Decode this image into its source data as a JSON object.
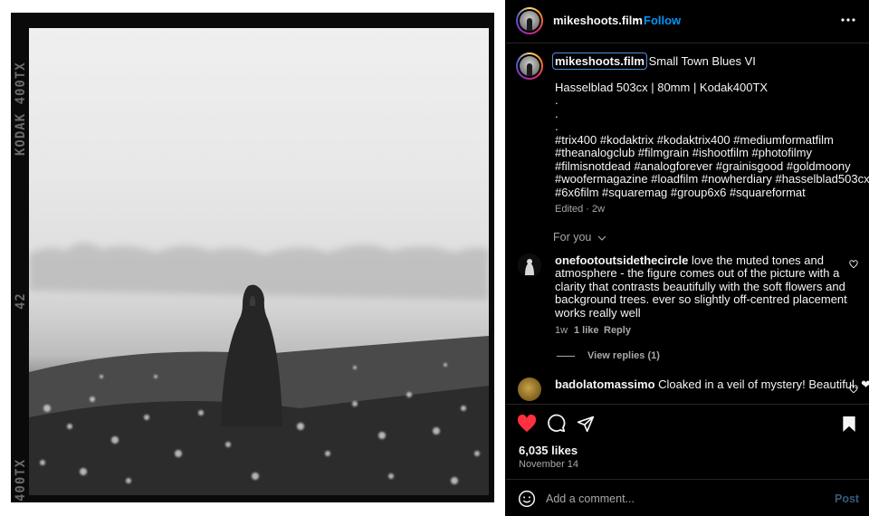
{
  "photo": {
    "edge_labels": [
      "KODAK 400TX",
      "42",
      "400TX"
    ]
  },
  "header": {
    "username": "mikeshoots.film",
    "separator": "•",
    "follow_label": "Follow",
    "more_icon": "more-horizontal-icon"
  },
  "caption": {
    "username": "mikeshoots.film",
    "title": "Small Town Blues VI",
    "camera": "Hasselblad 503cx | 80mm | Kodak400TX",
    "dots": [
      ".",
      ".",
      "."
    ],
    "hashtags": [
      "#trix400 #kodaktrix #kodaktrix400 #mediumformatfilm",
      "#theanalogclub #filmgrain #ishootfilm #photofilmy",
      "#filmisnotdead #analogforever #grainisgood #goldmoony",
      "#woofermagazine #loadfilm #nowherdiary #hasselblad503cx",
      "#6x6film #squaremag #group6x6 #squareformat"
    ],
    "meta": "Edited · 2w"
  },
  "for_you": {
    "label": "For you"
  },
  "comments": [
    {
      "username": "onefootoutsidethecircle",
      "lines": [
        "love the muted tones and",
        "atmosphere - the figure comes out of the picture with a",
        "clarity that contrasts beautifully with the soft flowers and",
        "background trees. ever so slightly off-centred placement",
        "works really well"
      ],
      "age": "1w",
      "likes": "1 like",
      "reply": "Reply",
      "view_replies": "View replies (1)"
    },
    {
      "username": "badolatomassimo",
      "text": "Cloaked in a veil of mystery! Beautiful. ❤"
    }
  ],
  "actions": {
    "like_icon": "heart-filled-icon",
    "comment_icon": "comment-icon",
    "share_icon": "send-icon",
    "save_icon": "bookmark-icon",
    "like_color": "#ff3040"
  },
  "stats": {
    "likes": "6,035 likes",
    "date": "November 14"
  },
  "composer": {
    "placeholder": "Add a comment...",
    "post_label": "Post",
    "emoji_icon": "emoji-icon"
  },
  "colors": {
    "accent": "#0095f6",
    "background": "#000000",
    "divider": "#262626"
  }
}
